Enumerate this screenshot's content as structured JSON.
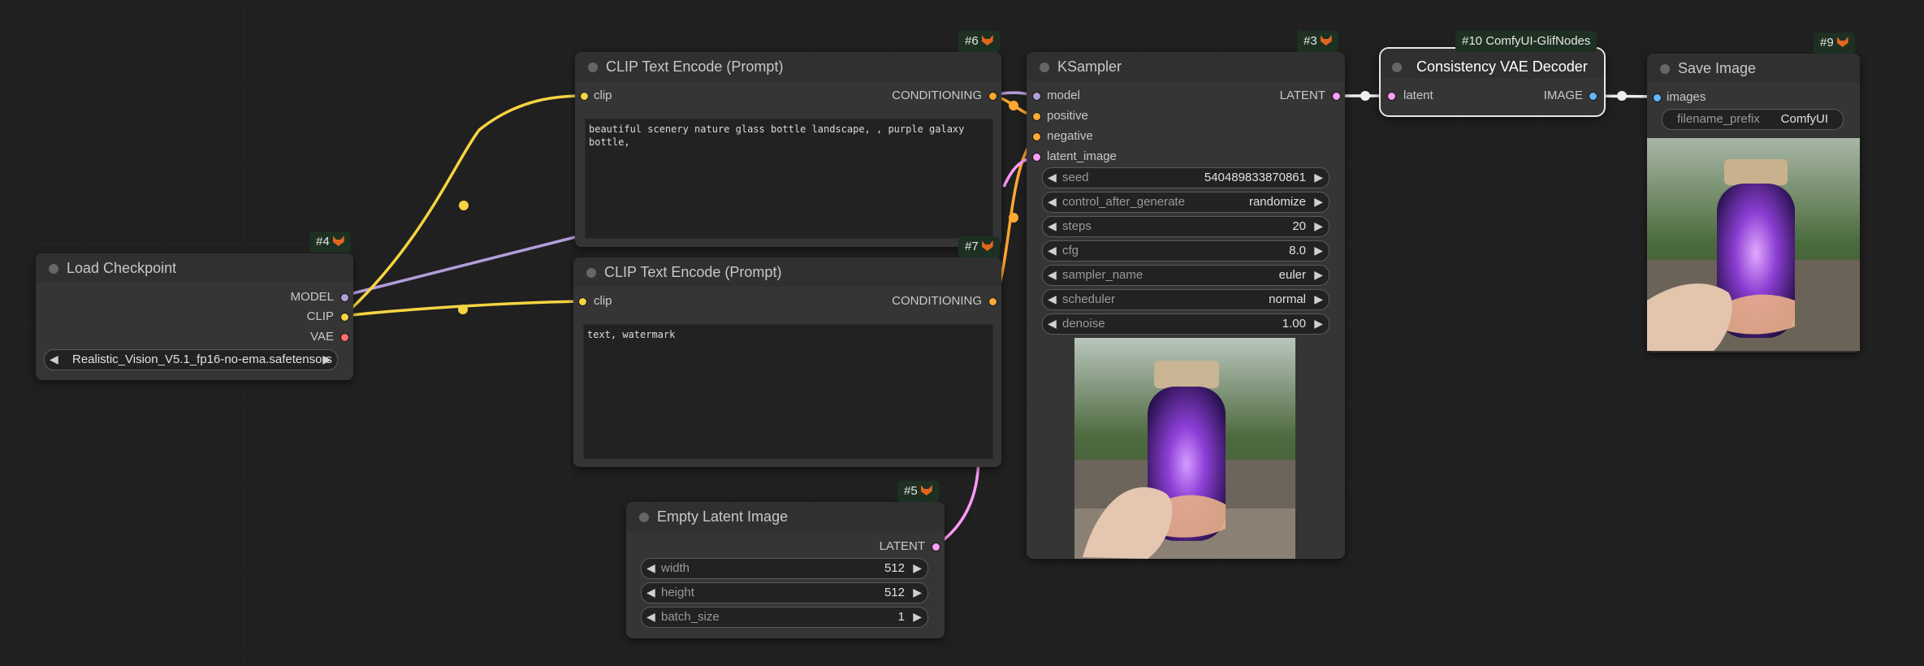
{
  "colors": {
    "model": "#b39ddb",
    "clip": "#f5d442",
    "vae": "#ff6e6e",
    "conditioning": "#ffa931",
    "latent": "#ff9cf9",
    "image": "#64b5f6"
  },
  "nodes": {
    "load_checkpoint": {
      "id_badge": "#4",
      "title": "Load Checkpoint",
      "outputs": [
        "MODEL",
        "CLIP",
        "VAE"
      ],
      "ckpt_name": "Realistic_Vision_V5.1_fp16-no-ema.safetensors"
    },
    "clip_pos": {
      "id_badge": "#6",
      "title": "CLIP Text Encode (Prompt)",
      "input": "clip",
      "output": "CONDITIONING",
      "text": "beautiful scenery nature glass bottle landscape, , purple galaxy bottle,"
    },
    "clip_neg": {
      "id_badge": "#7",
      "title": "CLIP Text Encode (Prompt)",
      "input": "clip",
      "output": "CONDITIONING",
      "text": "text, watermark"
    },
    "empty_latent": {
      "id_badge": "#5",
      "title": "Empty Latent Image",
      "output": "LATENT",
      "widgets": [
        {
          "label": "width",
          "value": "512"
        },
        {
          "label": "height",
          "value": "512"
        },
        {
          "label": "batch_size",
          "value": "1"
        }
      ]
    },
    "ksampler": {
      "id_badge": "#3",
      "title": "KSampler",
      "inputs": [
        "model",
        "positive",
        "negative",
        "latent_image"
      ],
      "output": "LATENT",
      "widgets": [
        {
          "label": "seed",
          "value": "540489833870861"
        },
        {
          "label": "control_after_generate",
          "value": "randomize"
        },
        {
          "label": "steps",
          "value": "20"
        },
        {
          "label": "cfg",
          "value": "8.0"
        },
        {
          "label": "sampler_name",
          "value": "euler"
        },
        {
          "label": "scheduler",
          "value": "normal"
        },
        {
          "label": "denoise",
          "value": "1.00"
        }
      ]
    },
    "vae_decoder": {
      "id_badge": "#10 ComfyUI-GlifNodes",
      "title": "Consistency VAE Decoder",
      "input": "latent",
      "output": "IMAGE"
    },
    "save_image": {
      "id_badge": "#9",
      "title": "Save Image",
      "input": "images",
      "filename_prefix_label": "filename_prefix",
      "filename_prefix_value": "ComfyUI"
    }
  },
  "icons": {
    "badge_icon": "fox-icon",
    "arrow_left": "◀",
    "arrow_right": "▶"
  }
}
